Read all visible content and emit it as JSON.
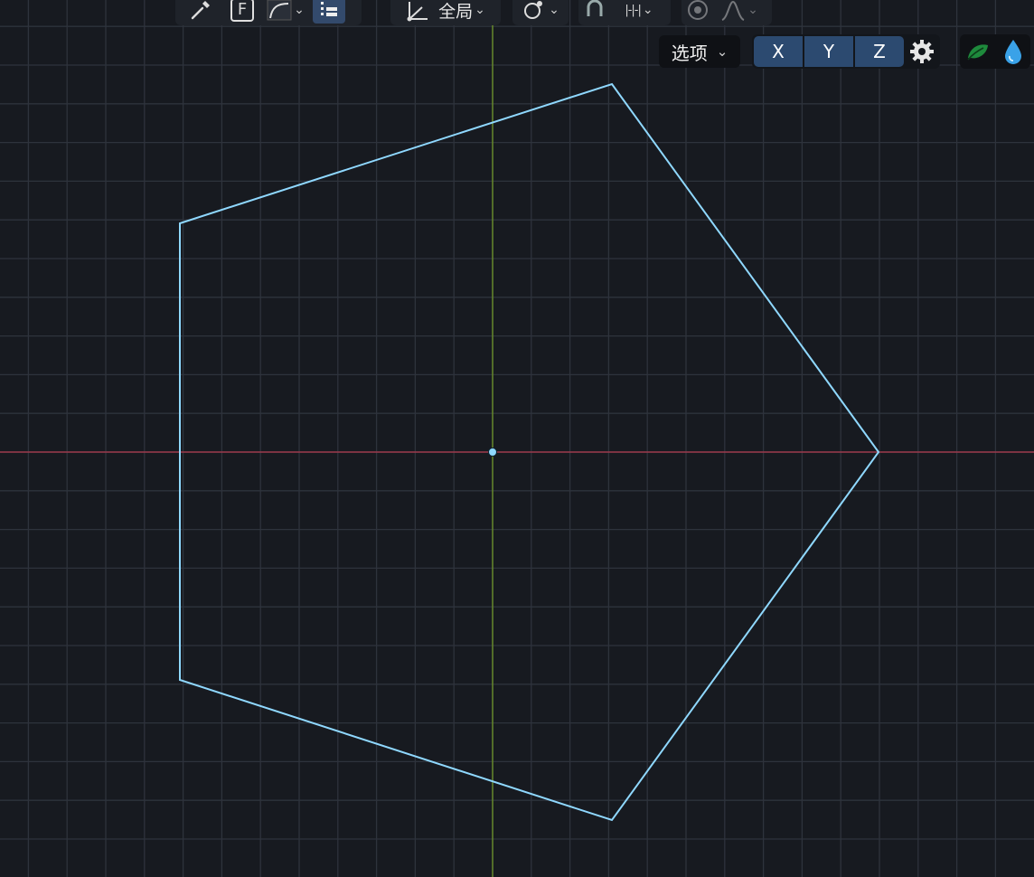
{
  "toolbar": {
    "transform_orientation": "全局",
    "face_key": "F",
    "snap_increment": "|-|-|"
  },
  "header_right": {
    "options_label": "选项",
    "axes": [
      "X",
      "Y",
      "Z"
    ]
  },
  "colors": {
    "background": "#171a20",
    "grid": "#2e333c",
    "x_axis": "#9b3a4c",
    "y_axis": "#6a8e2a",
    "selection": "#8fd8ff",
    "axis_button": "#2c4a70"
  },
  "icons": {
    "eyedropper": "eyedropper-icon",
    "face": "face-mode-icon",
    "curve": "curve-icon",
    "list": "list-icon",
    "orientation": "transform-orientation-icon",
    "pivot": "pivot-icon",
    "snap": "snap-magnet-icon",
    "increment": "snap-increment-icon",
    "proportional": "proportional-edit-icon",
    "falloff": "falloff-icon",
    "gear": "gear-icon",
    "leaf": "leaf-icon",
    "drop": "water-drop-icon"
  }
}
